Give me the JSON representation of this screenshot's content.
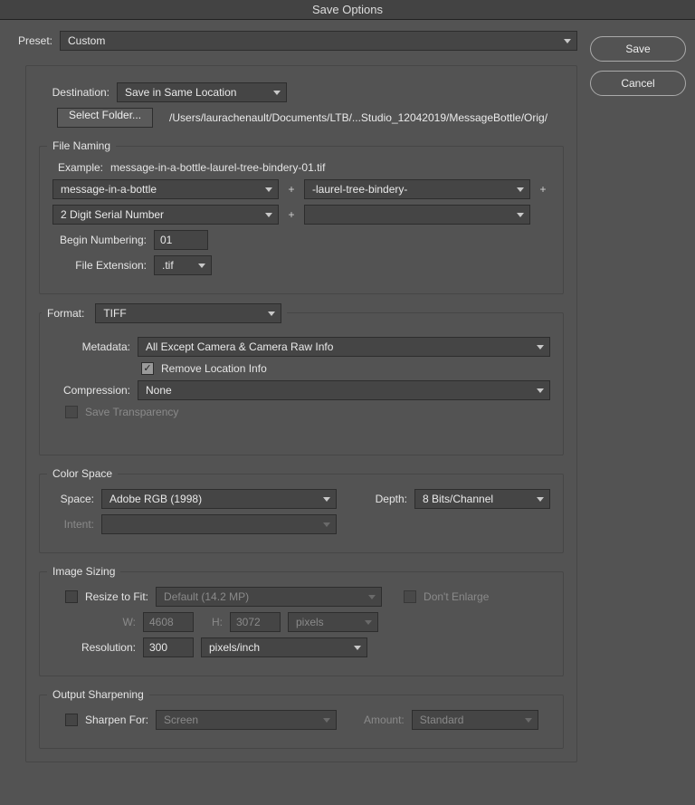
{
  "title": "Save Options",
  "buttons": {
    "save": "Save",
    "cancel": "Cancel",
    "selectFolder": "Select Folder..."
  },
  "preset": {
    "label": "Preset:",
    "value": "Custom"
  },
  "destination": {
    "label": "Destination:",
    "value": "Save in Same Location",
    "path": "/Users/laurachenault/Documents/LTB/...Studio_12042019/MessageBottle/Orig/"
  },
  "fileNaming": {
    "legend": "File Naming",
    "exampleLabel": "Example:",
    "example": "message-in-a-bottle-laurel-tree-bindery-01.tif",
    "token1": "message-in-a-bottle",
    "token2": "-laurel-tree-bindery-",
    "token3": "2 Digit Serial Number",
    "token4": "",
    "plus": "+",
    "beginNumberingLabel": "Begin Numbering:",
    "beginNumbering": "01",
    "fileExtLabel": "File Extension:",
    "fileExt": ".tif"
  },
  "format": {
    "label": "Format:",
    "value": "TIFF",
    "metadataLabel": "Metadata:",
    "metadata": "All Except Camera & Camera Raw Info",
    "removeLocation": "Remove Location Info",
    "compressionLabel": "Compression:",
    "compression": "None",
    "saveTransparency": "Save Transparency"
  },
  "colorSpace": {
    "legend": "Color Space",
    "spaceLabel": "Space:",
    "space": "Adobe RGB (1998)",
    "depthLabel": "Depth:",
    "depth": "8 Bits/Channel",
    "intentLabel": "Intent:",
    "intent": ""
  },
  "imageSizing": {
    "legend": "Image Sizing",
    "resizeLabel": "Resize to Fit:",
    "resizeValue": "Default  (14.2 MP)",
    "dontEnlarge": "Don't Enlarge",
    "wLabel": "W:",
    "w": "4608",
    "hLabel": "H:",
    "h": "3072",
    "unit": "pixels",
    "resolutionLabel": "Resolution:",
    "resolution": "300",
    "resolutionUnit": "pixels/inch"
  },
  "sharpening": {
    "legend": "Output Sharpening",
    "sharpenLabel": "Sharpen For:",
    "sharpenValue": "Screen",
    "amountLabel": "Amount:",
    "amountValue": "Standard"
  }
}
